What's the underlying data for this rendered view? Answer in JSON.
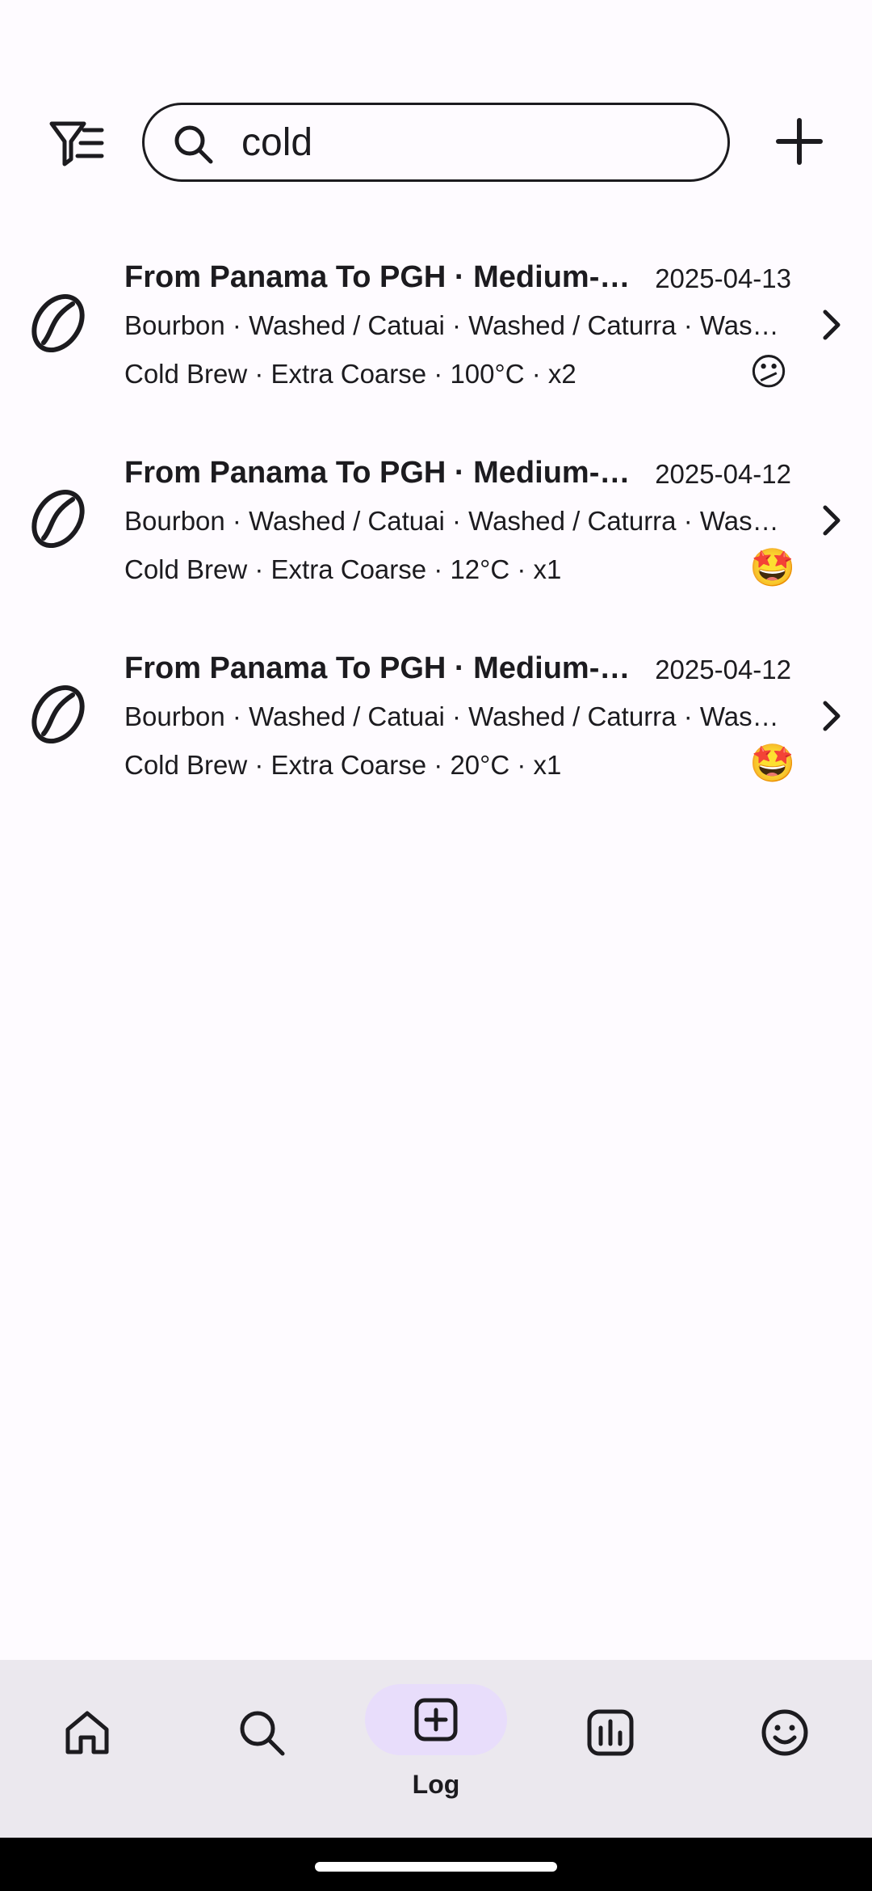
{
  "search": {
    "value": "cold",
    "placeholder": ""
  },
  "icons": {
    "filter": "filter-list-icon",
    "search": "search-icon",
    "add": "plus-icon",
    "bean": "coffee-bean-icon",
    "chevron": "chevron-right-icon"
  },
  "entries": [
    {
      "title": "From Panama To PGH · Medium-Light",
      "date": "2025-04-13",
      "varietals": "Bourbon · Washed / Catuai · Washed / Caturra · Washed",
      "details": "Cold Brew · Extra Coarse · 100°C · x2",
      "rating": "😕"
    },
    {
      "title": "From Panama To PGH · Medium-Light",
      "date": "2025-04-12",
      "varietals": "Bourbon · Washed / Catuai · Washed / Caturra · Washed",
      "details": "Cold Brew · Extra Coarse · 12°C · x1",
      "rating": "🤩"
    },
    {
      "title": "From Panama To PGH · Medium-Light",
      "date": "2025-04-12",
      "varietals": "Bourbon · Washed / Catuai · Washed / Caturra · Washed",
      "details": "Cold Brew · Extra Coarse · 20°C · x1",
      "rating": "🤩"
    }
  ],
  "nav": {
    "home_icon": "home-icon",
    "search_icon": "search-icon",
    "log_icon": "add-box-icon",
    "log_label": "Log",
    "stats_icon": "bar-chart-icon",
    "profile_icon": "smiley-icon"
  },
  "colors": {
    "background": "#fefbff",
    "nav_background": "#ebe8ee",
    "active_pill": "#e8ddfb",
    "text": "#1c1b1f"
  }
}
